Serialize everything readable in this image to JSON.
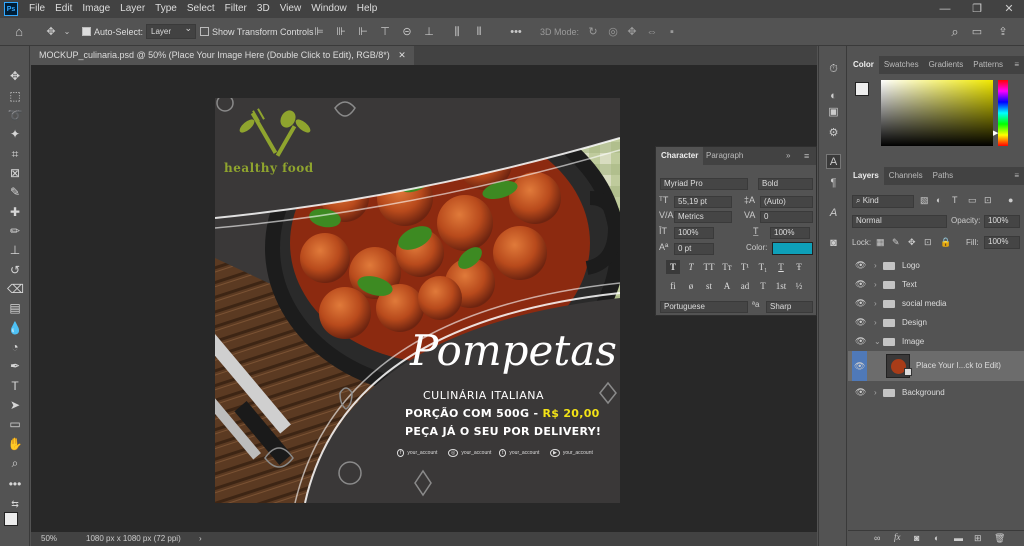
{
  "menubar": {
    "logo": "Ps",
    "items": [
      "File",
      "Edit",
      "Image",
      "Layer",
      "Type",
      "Select",
      "Filter",
      "3D",
      "View",
      "Window",
      "Help"
    ]
  },
  "options": {
    "auto_select_label": "Auto-Select:",
    "auto_select_value": "Layer",
    "show_transform_label": "Show Transform Controls",
    "mode_3d_label": "3D Mode:"
  },
  "document": {
    "tab_title": "MOCKUP_culinaria.psd @ 50% (Place Your Image Here (Double Click to Edit), RGB/8*)",
    "zoom": "50%",
    "doc_info": "1080 px x 1080 px (72 ppi)"
  },
  "artwork": {
    "logo_text": "healthy food",
    "title": "Pompetas",
    "line1": "CULINÁRIA ITALIANA",
    "line2_prefix": "PORÇÃO COM 500G - ",
    "line2_price": "R$ 20,00",
    "line3": "PEÇA JÁ O SEU POR DELIVERY!",
    "socials": [
      "your_account",
      "your_account",
      "your_account",
      "your_account"
    ]
  },
  "character_panel": {
    "tabs": [
      "Character",
      "Paragraph"
    ],
    "font_family": "Myriad Pro",
    "font_style": "Bold",
    "font_size": "55,19 pt",
    "leading": "(Auto)",
    "kerning": "Metrics",
    "tracking": "0",
    "vertical_scale": "100%",
    "horizontal_scale": "100%",
    "baseline_shift": "0 pt",
    "color_label": "Color:",
    "color_value": "#0ea0b9",
    "language": "Portuguese",
    "antialias": "Sharp",
    "style_buttons": [
      "T",
      "T",
      "TT",
      "Tт",
      "T¹",
      "T₁",
      "T",
      "Ŧ"
    ],
    "opentype_buttons": [
      "fi",
      "ø",
      "st",
      "A",
      "ad",
      "T",
      "1st",
      "½"
    ]
  },
  "color_panel": {
    "tabs": [
      "Color",
      "Swatches",
      "Gradients",
      "Patterns"
    ]
  },
  "layers_panel": {
    "tabs": [
      "Layers",
      "Channels",
      "Paths"
    ],
    "filter_kind": "Kind",
    "blend_mode": "Normal",
    "opacity_label": "Opacity:",
    "opacity_value": "100%",
    "lock_label": "Lock:",
    "fill_label": "Fill:",
    "fill_value": "100%",
    "layers": [
      {
        "name": "Logo",
        "type": "group"
      },
      {
        "name": "Text",
        "type": "group"
      },
      {
        "name": "social media",
        "type": "group"
      },
      {
        "name": "Design",
        "type": "group"
      },
      {
        "name": "Image",
        "type": "group-open"
      },
      {
        "name": "Place Your I...ck to Edit)",
        "type": "smart-object"
      },
      {
        "name": "Background",
        "type": "group"
      }
    ]
  }
}
